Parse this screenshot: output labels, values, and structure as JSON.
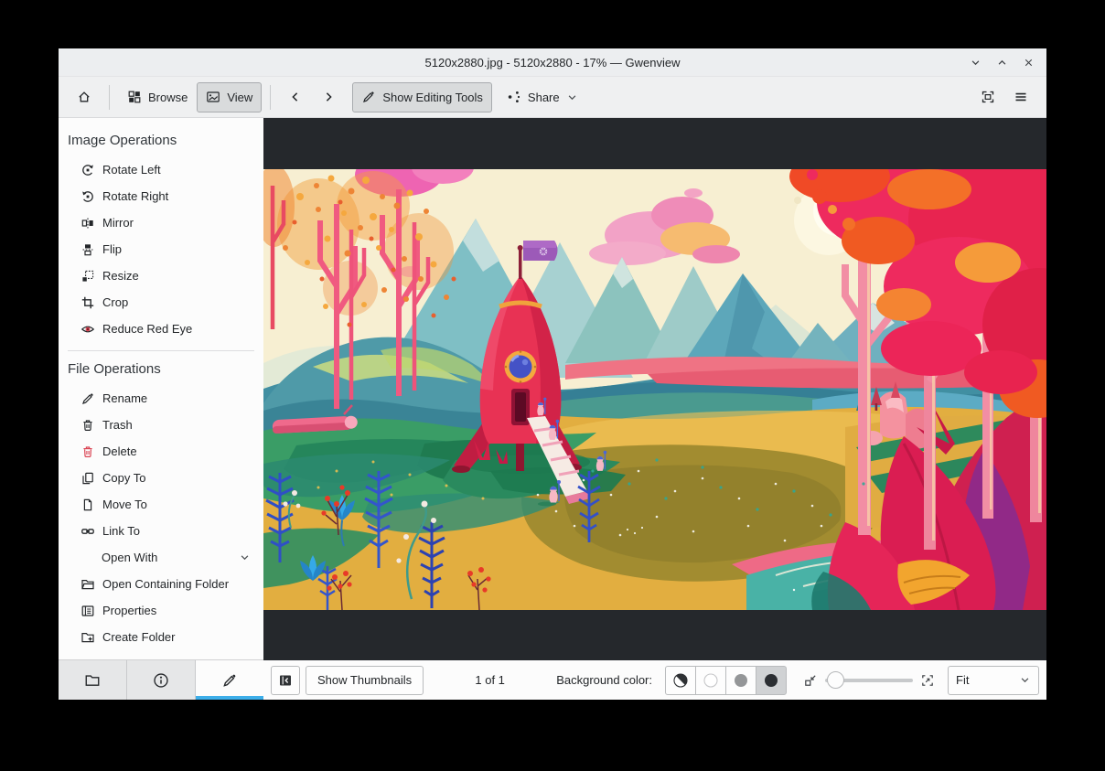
{
  "window": {
    "title": "5120x2880.jpg - 5120x2880 - 17% — Gwenview",
    "controls": {
      "minimize": "minimize",
      "maximize": "maximize",
      "close": "close"
    }
  },
  "toolbar": {
    "browse_label": "Browse",
    "view_label": "View",
    "show_editing_tools_label": "Show Editing Tools",
    "share_label": "Share"
  },
  "sidebar": {
    "image_operations_title": "Image Operations",
    "image_operations": [
      {
        "label": "Rotate Left",
        "icon": "rotate-left-icon"
      },
      {
        "label": "Rotate Right",
        "icon": "rotate-right-icon"
      },
      {
        "label": "Mirror",
        "icon": "mirror-icon"
      },
      {
        "label": "Flip",
        "icon": "flip-icon"
      },
      {
        "label": "Resize",
        "icon": "resize-icon"
      },
      {
        "label": "Crop",
        "icon": "crop-icon"
      },
      {
        "label": "Reduce Red Eye",
        "icon": "red-eye-icon"
      }
    ],
    "file_operations_title": "File Operations",
    "file_operations": [
      {
        "label": "Rename",
        "icon": "rename-icon"
      },
      {
        "label": "Trash",
        "icon": "trash-icon"
      },
      {
        "label": "Delete",
        "icon": "delete-icon"
      },
      {
        "label": "Copy To",
        "icon": "copy-icon"
      },
      {
        "label": "Move To",
        "icon": "move-icon"
      },
      {
        "label": "Link To",
        "icon": "link-icon"
      },
      {
        "label": "Open With",
        "icon": "submenu"
      },
      {
        "label": "Open Containing Folder",
        "icon": "folder-open-icon"
      },
      {
        "label": "Properties",
        "icon": "properties-icon"
      },
      {
        "label": "Create Folder",
        "icon": "folder-new-icon"
      }
    ],
    "tabs": [
      {
        "name": "folders"
      },
      {
        "name": "information"
      },
      {
        "name": "operations",
        "active": true
      }
    ]
  },
  "viewer": {
    "image_alt": "Colorful stylized sci-fi landscape: red rocket with purple flag and boarding ramp, tiny astronauts, teal mountains, pink clouds, golden meadow, pink-trunked autumn trees left, large red-orange trees right, teal pond and big crimson leaves bottom right"
  },
  "statusbar": {
    "show_thumbnails_label": "Show Thumbnails",
    "counter": "1 of 1",
    "background_color_label": "Background color:",
    "swatches": [
      "auto",
      "light",
      "gray",
      "dark"
    ],
    "selected_swatch": "dark",
    "zoom_select_value": "Fit"
  },
  "colors": {
    "accent": "#3daee9",
    "window_bg": "#eff0f1",
    "panel_bg": "#fcfcfc",
    "viewer_bg": "#25282c",
    "delete_red": "#da4453"
  }
}
